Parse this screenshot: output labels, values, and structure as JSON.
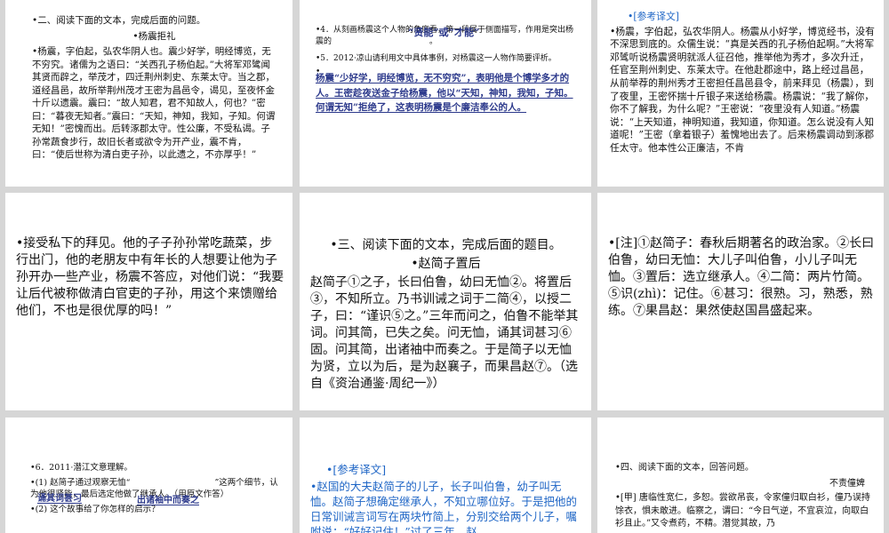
{
  "slides": {
    "s1": {
      "heading": "•二、阅读下面的文本，完成后面的问题。",
      "title": "•杨震拒礼",
      "body": "•杨震，字伯起，弘农华阴人也。震少好学，明经博览，无不穷究。诸儒为之语曰：“关西孔子杨伯起。”大将军邓骘闻其贤而辟之，举茂才，四迁荆州刺史、东莱太守。当之郡，道经昌邑，故所举荆州茂才王密为昌邑令，谒见，至夜怀金十斤以遗震。震曰：“故人知君，君不知故人，何也？”密曰：“暮夜无知者。”震曰：“天知，神知，我知，子知。何谓无知！”密愧而出。后转涿郡太守。性公廉，不受私谒。子孙常蔬食步行，故旧长者或欲令为开产业，震不肯，曰：“使后世称为清白吏子孙，以此遗之，不亦厚乎！”"
    },
    "s2": {
      "q4a": "•4．从刻画杨震这个人物的角度看，第一段属于侧面描写，作用是突出杨震的",
      "q4b": "。",
      "q4_answer": "“贤能”或“才能”",
      "q5": "•5．2012·凉山请利用文中具体事例，对杨震这一人物作简要评析。",
      "bullet": "•",
      "q5_answer": "杨震“少好学，明经博览，无不穷究”，表明他是个博学多才的人。王密趁夜送金子给杨震，他以“天知，神知，我知，子知。何谓无知”拒绝了，这表明杨震是个廉洁奉公的人。"
    },
    "s3": {
      "label": "•[参考译文]",
      "body": "•杨震，字伯起，弘农华阴人。杨震从小好学，博览经书，没有不深思到底的。众儒生说：“真是关西的孔子杨伯起啊。”大将军邓骘听说杨震贤明就派人征召他，推举他为秀才，多次升迁，任官至荆州刺史、东莱太守。在他赴郡途中，路上经过昌邑，从前举荐的荆州秀才王密担任昌邑县令，前来拜见（杨震），到了夜里，王密怀揣十斤银子来送给杨震。杨震说：“我了解你，你不了解我，为什么呢？”王密说：“夜里没有人知道。”杨震说：“上天知道，神明知道，我知道，你知道。怎么说没有人知道呢！”王密（拿着银子）羞愧地出去了。后来杨震调动到涿郡任太守。他本性公正廉洁，不肯"
    },
    "s4": {
      "body": "•接受私下的拜见。他的子子孙孙常吃蔬菜，步行出门，他的老朋友中有年长的人想要让他为子孙开办一些产业，杨震不答应，对他们说：“我要让后代被称做清白官吏的子孙，用这个来馈赠给他们，不也是很优厚的吗！”"
    },
    "s5": {
      "heading": "•三、阅读下面的文本，完成后面的题目。",
      "title": "•赵简子置后",
      "body": "赵简子①之子，长曰伯鲁，幼曰无恤②。将置后③，不知所立。乃书训诫之词于二简④，以授二子，曰：“谨识⑤之。”三年而问之，伯鲁不能举其词。问其简，已失之矣。问无恤，诵其词甚习⑥固。问其简，出诸袖中而奏之。于是简子以无恤为贤，立以为后，是为赵襄子，而果昌赵⑦。（选自《资治通鉴·周纪一》）"
    },
    "s6": {
      "body": "•[注]①赵简子：春秋后期著名的政治家。②长曰伯鲁，幼曰无恤：大儿子叫伯鲁，小儿子叫无恤。③置后：选立继承人。④二简：两片竹简。⑤识(zhì)：记住。⑥甚习：很熟。习，熟悉，熟练。⑦果昌赵：果然使赵国昌盛起来。"
    },
    "s7": {
      "q6": "•6．2011·潜江文意理解。",
      "q1a": "•(1) 赵简子通过观察无恤“",
      "q1b": "”",
      "q1c": "这两个细节，认为他很贤能，最后选定他做了继承人。（用原文作答）",
      "ans1": "诵其词甚习",
      "ans2": "出诸袖中而奏之",
      "q2": "•(2) 这个故事给了你怎样的启示？"
    },
    "s8": {
      "label": "•[参考译文]",
      "body": "•赵国的大夫赵简子的儿子，长子叫伯鲁，幼子叫无恤。赵简子想确定继承人，不知立哪位好。于是把他的日常训诫言词写在两块竹简上，分别交给两个儿子，嘱咐说：“好好记住！”过了三年，赵"
    },
    "s9": {
      "heading": "•四、阅读下面的文本，回答问题。",
      "title": "不责僮婢",
      "body": "•[甲] 唐临性宽仁，多恕。尝欲吊丧，令家僮归取白衫，僮乃误持馀衣，惧未敢进。临察之，谓曰：“今日气逆，不宜哀泣，向取白衫且止。”又令煮药，不精。潜觉其故，乃"
    }
  }
}
